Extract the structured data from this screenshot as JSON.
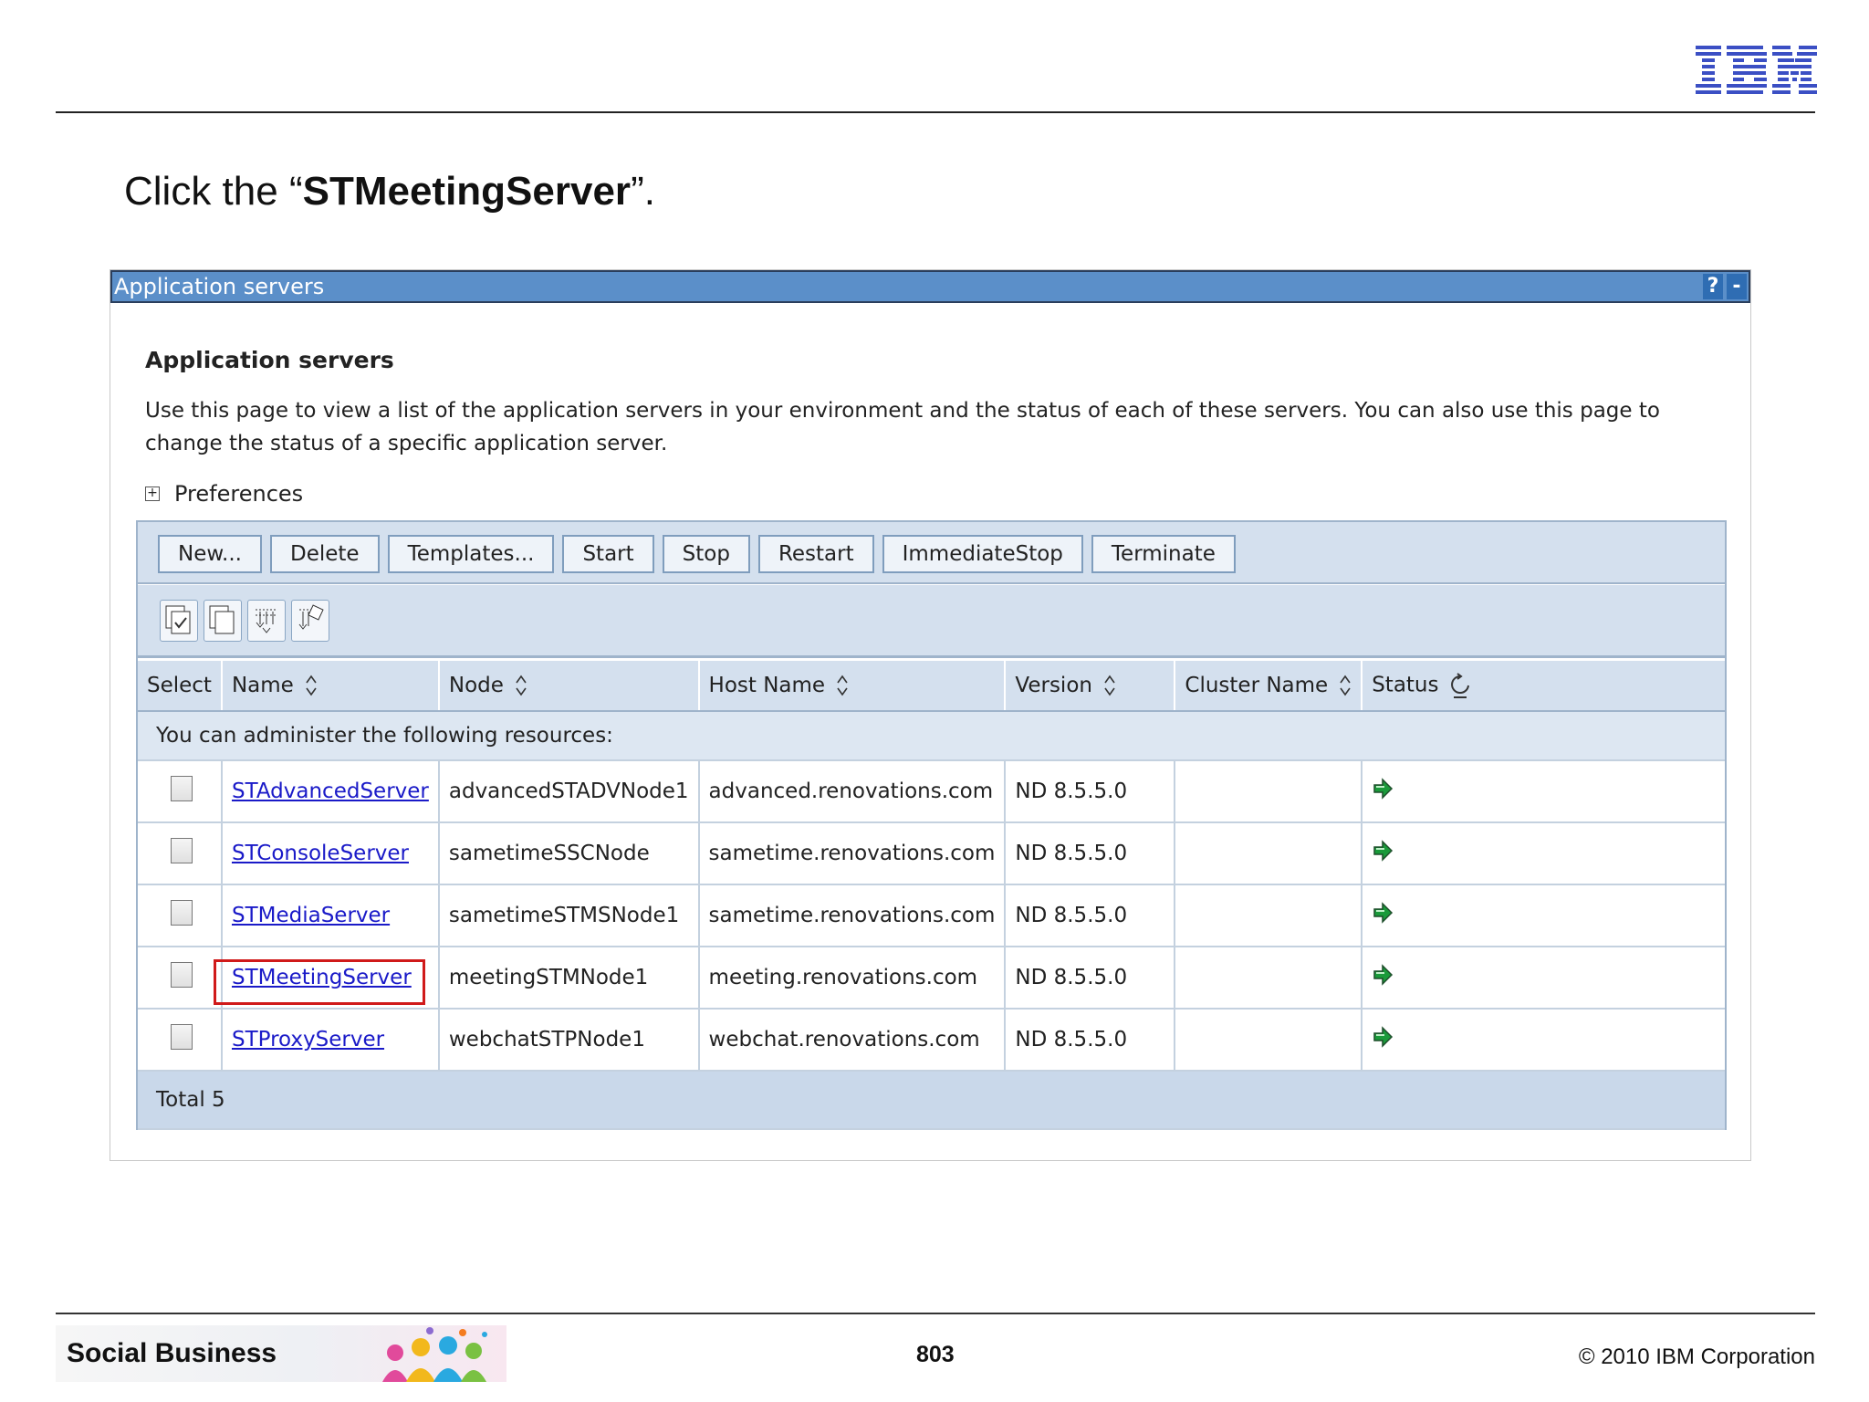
{
  "slide": {
    "instruction_prefix": "Click the “",
    "instruction_emph": "STMeetingServer",
    "instruction_suffix": "”.",
    "footer_brand": "Social Business",
    "page_number": "803",
    "copyright": "© 2010 IBM Corporation",
    "logo_text": "IBM"
  },
  "portlet": {
    "title": "Application servers",
    "help_icon": "?",
    "minimize_icon": "-",
    "heading": "Application servers",
    "description": "Use this page to view a list of the application servers in your environment and the status of each of these servers. You can also use this page to change the status of a specific application server.",
    "preferences_label": "Preferences"
  },
  "toolbar": {
    "buttons": [
      "New...",
      "Delete",
      "Templates...",
      "Start",
      "Stop",
      "Restart",
      "ImmediateStop",
      "Terminate"
    ],
    "icons": [
      "select-all-icon",
      "deselect-all-icon",
      "show-filter-icon",
      "clear-filter-icon"
    ]
  },
  "table": {
    "columns": [
      "Select",
      "Name",
      "Node",
      "Host Name",
      "Version",
      "Cluster Name",
      "Status"
    ],
    "admin_note": "You can administer the following resources:",
    "rows": [
      {
        "name": "STAdvancedServer",
        "node": "advancedSTADVNode1",
        "host": "advanced.renovations.com",
        "version": "ND 8.5.5.0",
        "cluster": "",
        "status": "started"
      },
      {
        "name": "STConsoleServer",
        "node": "sametimeSSCNode",
        "host": "sametime.renovations.com",
        "version": "ND 8.5.5.0",
        "cluster": "",
        "status": "started"
      },
      {
        "name": "STMediaServer",
        "node": "sametimeSTMSNode1",
        "host": "sametime.renovations.com",
        "version": "ND 8.5.5.0",
        "cluster": "",
        "status": "started"
      },
      {
        "name": "STMeetingServer",
        "node": "meetingSTMNode1",
        "host": "meeting.renovations.com",
        "version": "ND 8.5.5.0",
        "cluster": "",
        "status": "started"
      },
      {
        "name": "STProxyServer",
        "node": "webchatSTPNode1",
        "host": "webchat.renovations.com",
        "version": "ND 8.5.5.0",
        "cluster": "",
        "status": "started"
      }
    ],
    "total": "Total 5"
  },
  "colors": {
    "title_bar": "#5b8fc9",
    "header_bg": "#d4e0ee",
    "link": "#1a1ac8",
    "highlight": "#d01a1a",
    "status_started": "#1a9a3a"
  }
}
